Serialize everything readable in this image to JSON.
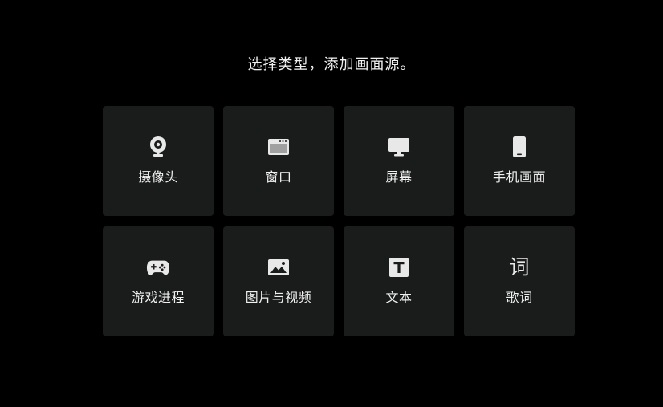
{
  "title": "选择类型，添加画面源。",
  "tiles": [
    {
      "label": "摄像头",
      "icon": "webcam-icon"
    },
    {
      "label": "窗口",
      "icon": "window-icon"
    },
    {
      "label": "屏幕",
      "icon": "monitor-icon"
    },
    {
      "label": "手机画面",
      "icon": "phone-icon"
    },
    {
      "label": "游戏进程",
      "icon": "gamepad-icon"
    },
    {
      "label": "图片与视频",
      "icon": "image-icon"
    },
    {
      "label": "文本",
      "icon": "text-icon"
    },
    {
      "label": "歌词",
      "icon": "lyrics-icon",
      "glyph": "词"
    }
  ],
  "colors": {
    "background": "#000000",
    "tile": "#1a1b1b",
    "text": "#f0f0f0",
    "icon": "#e8e8e8"
  }
}
